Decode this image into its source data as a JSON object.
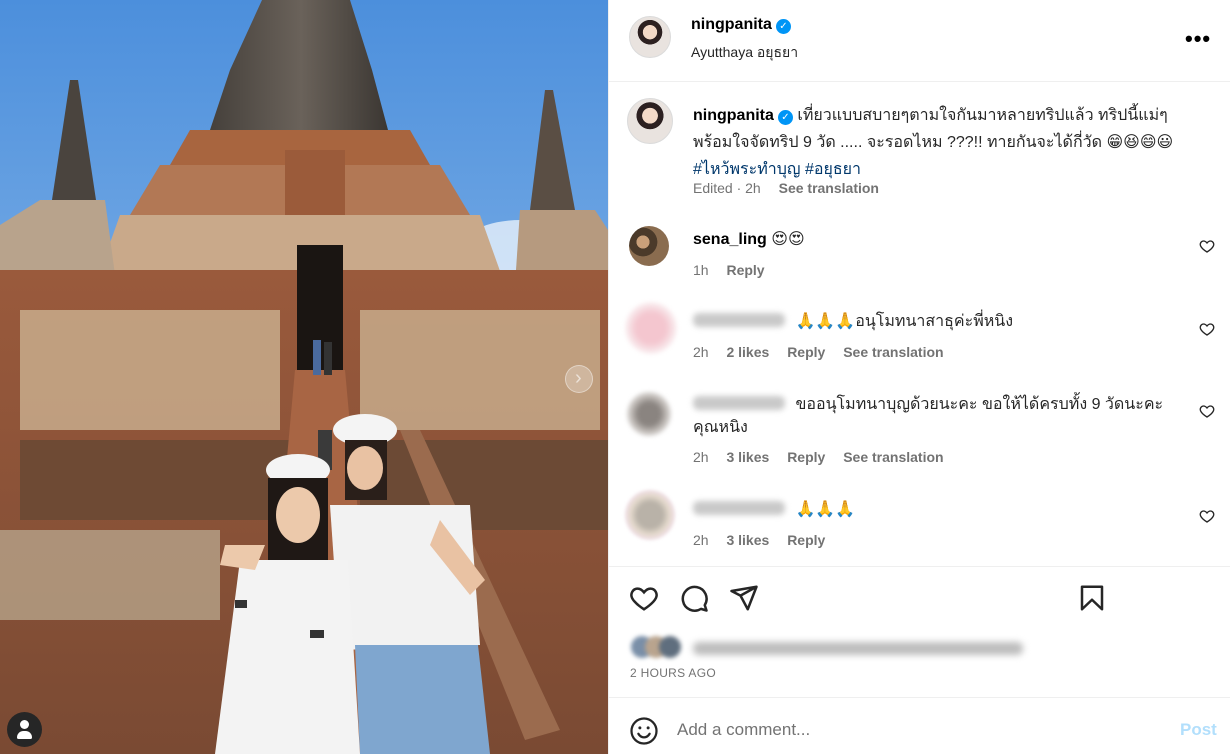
{
  "post": {
    "username": "ningpanita",
    "location": "Ayutthaya อยุธยา",
    "more_icon": "more-horizontal-icon"
  },
  "caption": {
    "username": "ningpanita",
    "text": "เที่ยวแบบสบายๆตามใจกันมาหลายทริปแล้ว ทริปนี้แม่ๆพร้อมใจจัดทริป 9 วัด ..... จะรอดไหม ???!! ทายกันจะได้กี่วัด 😁😆😄😃",
    "hashtags": [
      "#ไหว้พระทำบุญ",
      "#อยุธยา"
    ],
    "meta_time": "Edited · 2h",
    "see_translation": "See translation"
  },
  "comments": [
    {
      "username": "sena_ling",
      "text": "😍😍",
      "time": "1h",
      "likes": "",
      "reply": "Reply",
      "see_translation": ""
    },
    {
      "username": "",
      "text": "🙏🙏🙏อนุโมทนาสาธุค่ะพี่หนิง",
      "time": "2h",
      "likes": "2 likes",
      "reply": "Reply",
      "see_translation": "See translation"
    },
    {
      "username": "",
      "text": "ขออนุโมทนาบุญด้วยนะคะ ขอให้ได้ครบทั้ง 9 วัดนะคะ คุณหนิง",
      "time": "2h",
      "likes": "3 likes",
      "reply": "Reply",
      "see_translation": "See translation"
    },
    {
      "username": "",
      "text": "🙏🙏🙏",
      "time": "2h",
      "likes": "3 likes",
      "reply": "Reply",
      "see_translation": ""
    }
  ],
  "actions": {
    "like_icon": "heart-icon",
    "comment_icon": "comment-icon",
    "share_icon": "share-icon",
    "save_icon": "bookmark-icon"
  },
  "time_ago": "2 HOURS AGO",
  "add_comment": {
    "placeholder": "Add a comment...",
    "post_label": "Post"
  },
  "colors": {
    "verified": "#0095f6",
    "hashtag": "#00376b",
    "secondary_text": "#737373",
    "post_disabled": "#b2dffc",
    "border": "#efefef"
  }
}
